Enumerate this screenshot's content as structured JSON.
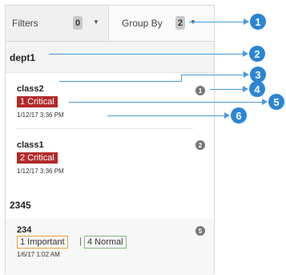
{
  "toolbar": {
    "filters_label": "Filters",
    "filters_count": "0",
    "group_by_label": "Group By",
    "group_by_count": "2"
  },
  "groups": [
    {
      "label": "dept1"
    },
    {
      "label": "2345"
    }
  ],
  "items": [
    {
      "name": "class2",
      "count": "1",
      "critical": "1 Critical",
      "time": "1/12/17 3:36 PM"
    },
    {
      "name": "class1",
      "count": "2",
      "critical": "2 Critical",
      "time": "1/12/17 3:36 PM"
    },
    {
      "name": "234",
      "count": "5",
      "important": "1 Important",
      "separator": "|",
      "normal": "4 Normal",
      "time": "1/6/17 1:02 AM"
    }
  ],
  "callouts": [
    "1",
    "2",
    "3",
    "4",
    "5",
    "6"
  ],
  "colors": {
    "critical": "#b22a2a",
    "important_border": "#e8a23a",
    "normal_border": "#7fb77e",
    "callout": "#2b85d4"
  }
}
